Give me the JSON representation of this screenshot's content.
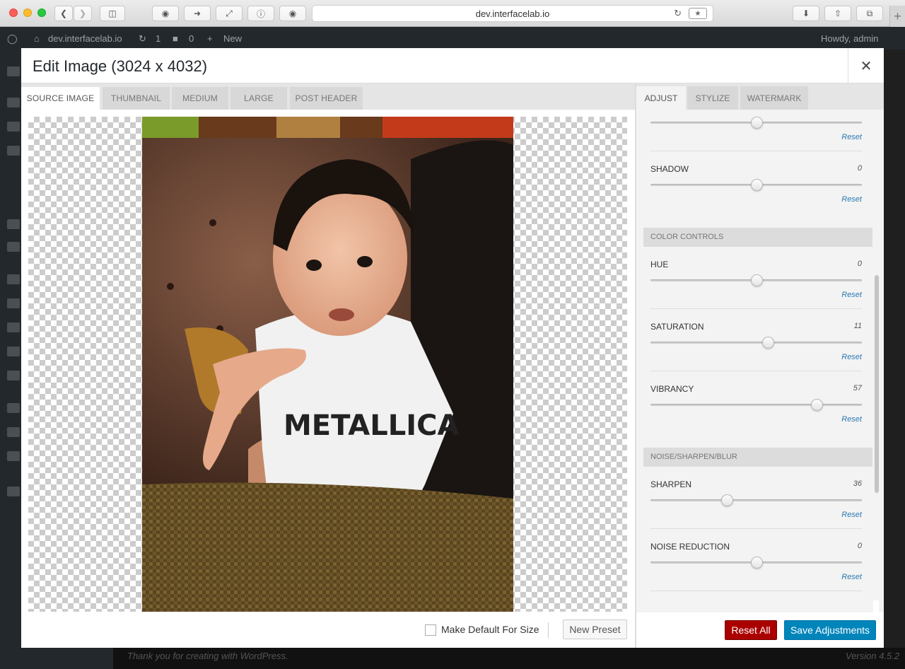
{
  "browser": {
    "url": "dev.interfacelab.io",
    "reader_label": "★"
  },
  "adminbar": {
    "site": "dev.interfacelab.io",
    "updates": "1",
    "comments": "0",
    "new": "New",
    "howdy": "Howdy, admin"
  },
  "footer": {
    "thanks": "Thank you for creating with WordPress.",
    "version": "Version 4.5.2"
  },
  "modal": {
    "title": "Edit Image (3024 x 4032)",
    "close": "✕"
  },
  "size_tabs": [
    {
      "label": "Source Image",
      "active": true
    },
    {
      "label": "Thumbnail",
      "active": false
    },
    {
      "label": "Medium",
      "active": false
    },
    {
      "label": "Large",
      "active": false
    },
    {
      "label": "Post Header",
      "active": false
    }
  ],
  "adjust_tabs": [
    {
      "label": "Adjust",
      "active": true
    },
    {
      "label": "Stylize",
      "active": false
    },
    {
      "label": "Watermark",
      "active": false
    }
  ],
  "left_footer": {
    "make_default": "Make Default For Size",
    "new_preset": "New Preset"
  },
  "controls": {
    "top_partial": {
      "level": 0.5,
      "reset": "Reset"
    },
    "shadow": {
      "label": "Shadow",
      "value": "0",
      "level": 0.5,
      "reset": "Reset"
    },
    "color_section": "Color Controls",
    "hue": {
      "label": "Hue",
      "value": "0",
      "level": 0.5,
      "reset": "Reset"
    },
    "saturation": {
      "label": "Saturation",
      "value": "11",
      "level": 0.555,
      "reset": "Reset"
    },
    "vibrancy": {
      "label": "Vibrancy",
      "value": "57",
      "level": 0.785,
      "reset": "Reset"
    },
    "noise_section": "Noise/Sharpen/Blur",
    "sharpen": {
      "label": "Sharpen",
      "value": "36",
      "level": 0.36,
      "reset": "Reset"
    },
    "noise_reduction": {
      "label": "Noise Reduction",
      "value": "0",
      "level": 0.5,
      "reset": "Reset"
    }
  },
  "right_footer": {
    "reset_all": "Reset All",
    "save": "Save Adjustments"
  },
  "colors": {
    "accent_blue": "#0085ba",
    "danger_red": "#aa0000",
    "link_blue": "#2a7ab0"
  }
}
